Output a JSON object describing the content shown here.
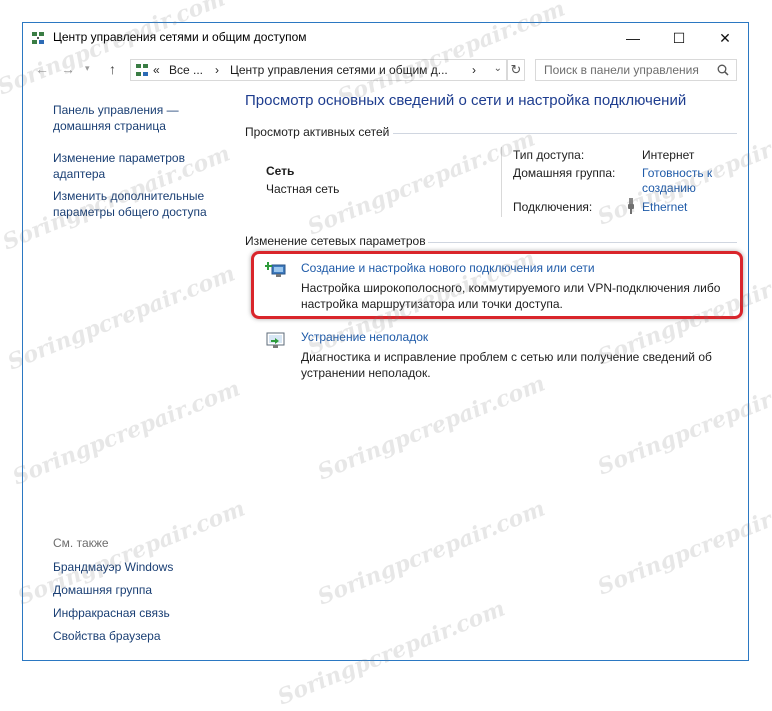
{
  "window": {
    "title": "Центр управления сетями и общим доступом",
    "controls": {
      "minimize": "—",
      "maximize": "☐",
      "close": "✕"
    }
  },
  "nav": {
    "back": "←",
    "forward": "→",
    "recent": "▾",
    "up": "↑",
    "address_prefix": "«",
    "address_segments": [
      "Все ...",
      "›",
      "Центр управления сетями и общим д...",
      "›"
    ],
    "address_dropdown": "⌄",
    "refresh": "↻",
    "search_placeholder": "Поиск в панели управления"
  },
  "sidebar": {
    "home": [
      "Панель управления —",
      "домашняя страница"
    ],
    "items": [
      [
        "Изменение параметров",
        "адаптера"
      ],
      [
        "Изменить дополнительные",
        "параметры общего доступа"
      ]
    ],
    "see_also_title": "См. также",
    "see_also": [
      "Брандмауэр Windows",
      "Домашняя группа",
      "Инфракрасная связь",
      "Свойства браузера"
    ]
  },
  "main": {
    "title": "Просмотр основных сведений о сети и настройка подключений",
    "active_section": "Просмотр активных сетей",
    "network": {
      "name": "Сеть",
      "type": "Частная сеть",
      "access_label": "Тип доступа:",
      "access_value": "Интернет",
      "homegroup_label": "Домашняя группа:",
      "homegroup_value": [
        "Готовность к",
        "созданию"
      ],
      "connections_label": "Подключения:",
      "connections_value": "Ethernet"
    },
    "change_section": "Изменение сетевых параметров",
    "tasks": [
      {
        "title": "Создание и настройка нового подключения или сети",
        "desc": [
          "Настройка широкополосного, коммутируемого или VPN-подключения либо",
          "настройка маршрутизатора или точки доступа."
        ]
      },
      {
        "title": "Устранение неполадок",
        "desc": [
          "Диагностика и исправление проблем с сетью или получение сведений об",
          "устранении неполадок."
        ]
      }
    ]
  },
  "watermark": "Soringpcrepair.com",
  "colors": {
    "link": "#1e5aa8",
    "title": "#1e3d8f",
    "highlight": "#d9252b",
    "border": "#2b78c2"
  }
}
